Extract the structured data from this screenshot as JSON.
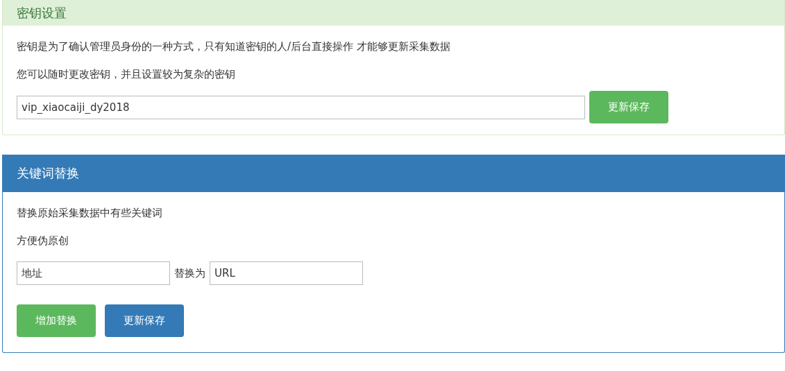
{
  "panels": [
    {
      "kind": "success",
      "title": "密钥设置",
      "lines": [
        "密钥是为了确认管理员身份的一种方式，只有知道密钥的人/后台直接操作 才能够更新采集数据",
        "您可以随时更改密钥，并且设置较为复杂的密钥"
      ],
      "form": [
        {
          "kind": "field",
          "value": "vip_xiaocaiji_dy2018"
        },
        {
          "kind": "button",
          "label": "更新保存",
          "color": "#5cb85c"
        }
      ]
    },
    {
      "kind": "primary",
      "title": "关键词替换",
      "lines": [
        "替换原始采集数据中有些关键词",
        "方便伪原创"
      ],
      "form": [
        {
          "kind": "field",
          "value": "地址"
        },
        {
          "kind": "label",
          "text": "替换为"
        },
        {
          "kind": "field",
          "value": "URL"
        }
      ],
      "buttons": [
        {
          "label": "增加替换",
          "color": "#5cb85c"
        },
        {
          "label": "更新保存",
          "color": "#337ab7"
        }
      ]
    }
  ]
}
